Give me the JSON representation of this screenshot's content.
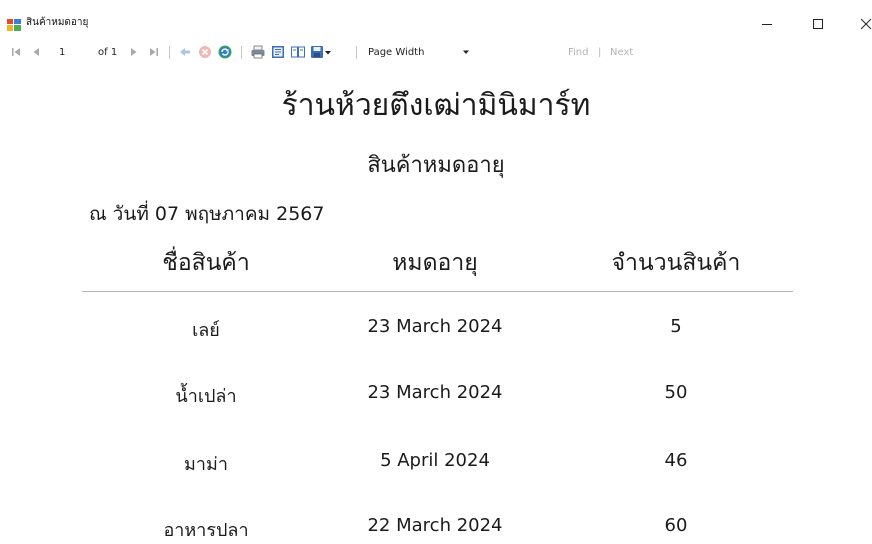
{
  "window": {
    "title": "สินค้าหมดอายุ",
    "controls": [
      "minimize",
      "maximize",
      "close"
    ]
  },
  "toolbar": {
    "page_current": "1",
    "page_of": "of 1",
    "zoom_value": "Page Width",
    "find_label": "Find",
    "separator": "|",
    "next_label": "Next",
    "icons": [
      "first-page",
      "previous-page",
      "next-page",
      "last-page",
      "back",
      "stop",
      "refresh",
      "print",
      "print-layout",
      "page-setup",
      "export"
    ]
  },
  "report": {
    "title": "ร้านห้วยตึงเฒ่ามินิมาร์ท",
    "subtitle": "สินค้าหมดอายุ",
    "date_line": "ณ วันที่ 07 พฤษภาคม 2567",
    "columns": [
      "ชื่อสินค้า",
      "หมดอายุ",
      "จำนวนสินค้า"
    ],
    "rows": [
      {
        "name": "เลย์",
        "expiry": "23 March 2024",
        "qty": "5"
      },
      {
        "name": "น้ำเปล่า",
        "expiry": "23 March 2024",
        "qty": "50"
      },
      {
        "name": "มาม่า",
        "expiry": "5 April 2024",
        "qty": "46"
      },
      {
        "name": "อาหารปลา",
        "expiry": "22 March 2024",
        "qty": "60"
      }
    ]
  }
}
